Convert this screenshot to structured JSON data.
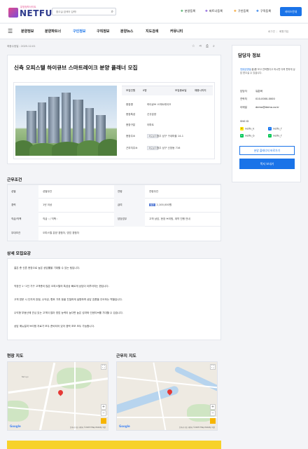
{
  "header": {
    "logo_small": "분양정보사이트",
    "logo_text": "NETFU",
    "search_placeholder": "찾으실 검색어 입력!",
    "actions": [
      {
        "label": "분양등록",
        "color": "#3aa757"
      },
      {
        "label": "파트너등록",
        "color": "#7b4dd8"
      },
      {
        "label": "구인등록",
        "color": "#f29c1f"
      },
      {
        "label": "구직등록",
        "color": "#1a73e8"
      }
    ],
    "service_button": "서비스안내"
  },
  "nav": {
    "items": [
      "분양정보",
      "분양파트너",
      "구인정보",
      "구직정보",
      "분양뉴스",
      "지도검색",
      "커뮤니티"
    ],
    "active_index": 2,
    "login": "로그인",
    "signup": "회원가입"
  },
  "breadcrumb": "최종수정일 : 2025.12.01",
  "post": {
    "title": "신축 오피스텔 하이큐브 스마트레이크 분양 플래너 모집",
    "recruit_count_label": "모집인원",
    "recruit_count": "0명",
    "recruit_status_label": "모집종료일",
    "recruit_status": "채용시까지",
    "info": [
      {
        "label": "현장명",
        "value": "하이큐브 스마트레이크"
      },
      {
        "label": "현장특성",
        "value": "신규분양"
      },
      {
        "label": "현장구분",
        "value": "아파트"
      },
      {
        "label": "현장주소",
        "tag": "지도보기",
        "value": "광주 남구 구내마을 14-1"
      },
      {
        "label": "근무지주소",
        "tag": "지도보기",
        "value": "광주 남구 신장동 716"
      }
    ]
  },
  "sidebar": {
    "title": "담당자 정보",
    "desc_highlight": "넷퓨분양팀",
    "desc": "(을)를 보고 연락했다고 하시면 더욱 편하게 상담 받으실 수 있습니다.",
    "rows": [
      {
        "label": "담당자",
        "value": "유춘혁"
      },
      {
        "label": "연락처",
        "value": "010-0000-0000"
      },
      {
        "label": "이메일",
        "value": "demo@demo.co.kr"
      }
    ],
    "sns_title": "SNS ID",
    "sns": [
      {
        "icon": "kakao-icon",
        "name": "netfu_k",
        "color": "#3a1d1d",
        "bg": "#fee500"
      },
      {
        "icon": "facebook-icon",
        "name": "netfu_f",
        "color": "#fff",
        "bg": "#1877f2"
      },
      {
        "icon": "blog-icon",
        "name": "netfu_b",
        "color": "#fff",
        "bg": "#03c75a"
      },
      {
        "icon": "line-icon",
        "name": "netfu_f",
        "color": "#fff",
        "bg": "#06c755"
      }
    ],
    "button_outline": "분양 플래너지 바로가기",
    "button_primary": "쪽지 보내기"
  },
  "conditions": {
    "title": "근무조건",
    "rows": [
      [
        {
          "label": "성별",
          "value": "성별무관"
        },
        {
          "label": "연령",
          "value": "연령무관"
        }
      ],
      [
        {
          "label": "경력",
          "value": "1년 이상"
        },
        {
          "label": "급여",
          "badge": "월급",
          "value": "2,100,000원"
        }
      ],
      [
        {
          "label": "직급/직책",
          "value": "직급 : / 직책 :"
        },
        {
          "label": "담당업무",
          "value": "고객 상담, 현장 브리핑, 계약 진행 안내"
        }
      ],
      [
        {
          "label": "우대조건",
          "value": "오피스텔 분양 경험자, 영업 경험자"
        }
      ]
    ]
  },
  "detail": {
    "title": "상세 모집요강",
    "paragraphs": [
      "젊은 층 신혼 현장으로 높은 상담률을 기대할 수 있는 팀입니다.",
      "직장인 1~2인 가구 고객층이 많은 오피스텔의 특성상 빠르게 상담이 이루어지는 편입니다.",
      "고객 방문 시 단지의 장점, 수익성, 향후 가치 등을 친절하게 설명하며 상담 흐름을 주도하는 역할입니다.",
      "수익형 부동산에 관심 있는 고객이 많아 영업 능력이 높다면 높은 성과와 인센티브를 기대할 수 있습니다.",
      "상담 매뉴얼과 브리핑 자료가 모두 준비되어 있어 경력 초보 모두 가능합니다."
    ]
  },
  "maps": {
    "site_title": "현장 지도",
    "work_title": "근무지 지도",
    "google": "Google",
    "copyright": "단축키  지도 데이터 ©2025 TMap Mobility  약관"
  }
}
